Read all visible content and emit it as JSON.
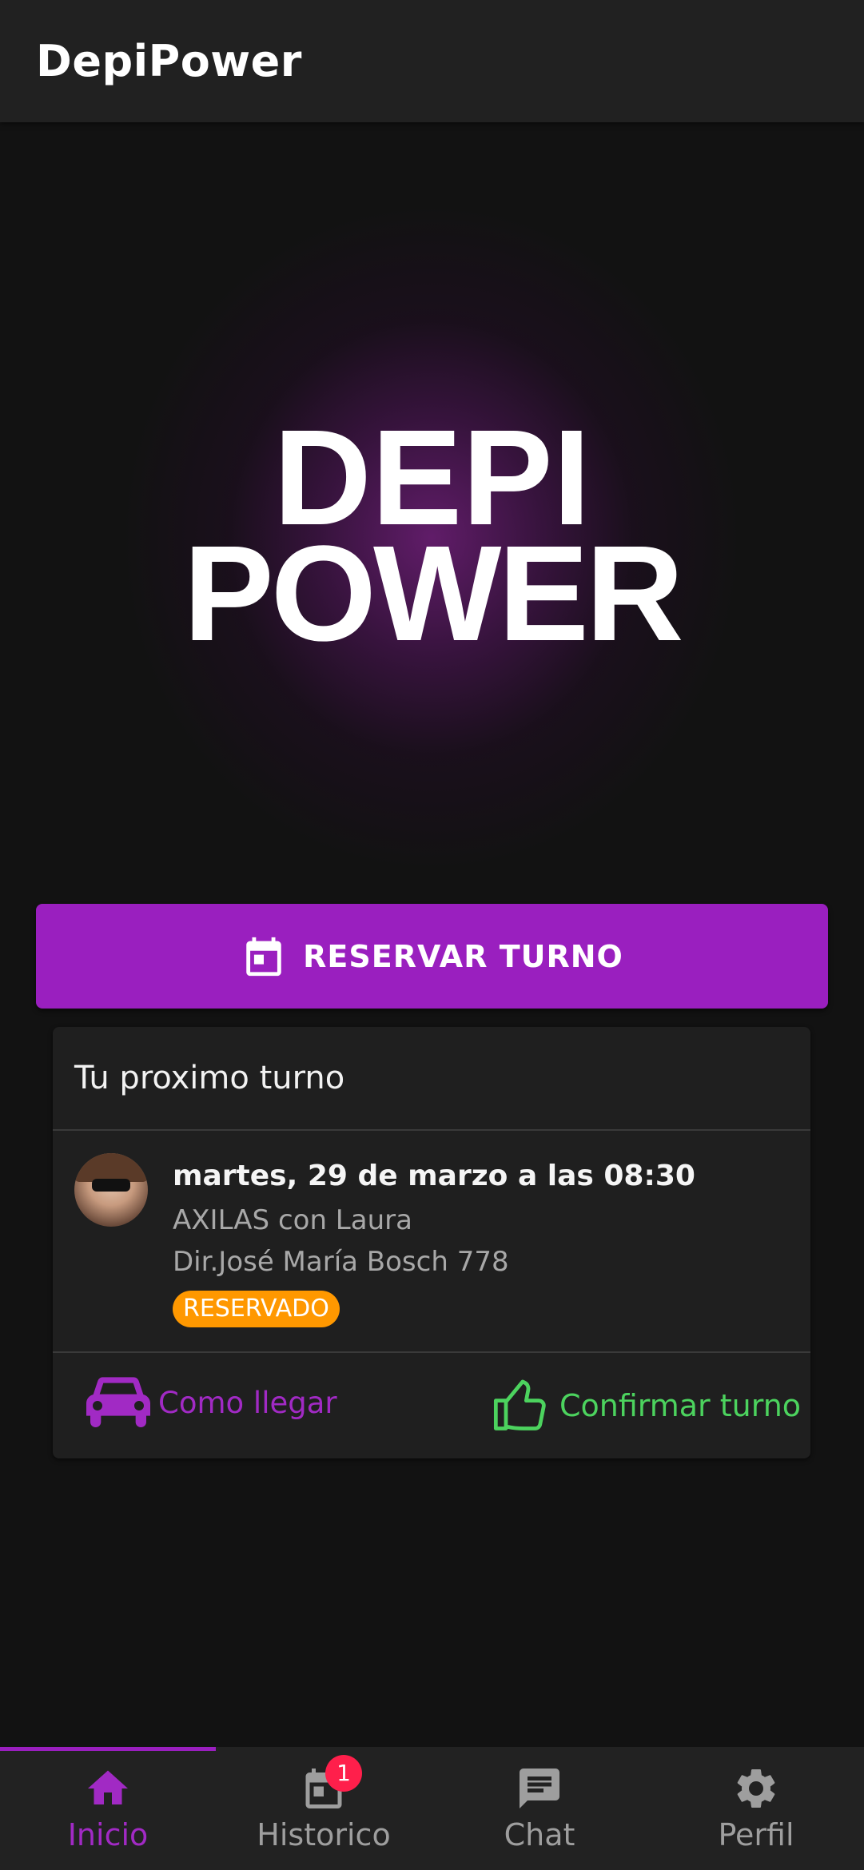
{
  "app": {
    "title": "DepiPower"
  },
  "hero": {
    "logo_line1": "DEPI",
    "logo_line2": "POWER"
  },
  "reserve_button": {
    "label": "RESERVAR TURNO",
    "icon": "calendar-icon"
  },
  "next_appointment": {
    "title": "Tu proximo turno",
    "date": "martes, 29 de marzo a las 08:30",
    "service": "AXILAS con Laura",
    "address": "Dir.José María Bosch 778",
    "status": "RESERVADO",
    "status_color": "#ff9800",
    "actions": {
      "directions": {
        "label": "Como llegar",
        "icon": "car-icon",
        "color": "#a12ac4"
      },
      "confirm": {
        "label": "Confirmar turno",
        "icon": "thumbs-up-icon",
        "color": "#4cd35e"
      }
    }
  },
  "bottom_nav": {
    "items": [
      {
        "label": "Inicio",
        "icon": "home-icon",
        "active": true
      },
      {
        "label": "Historico",
        "icon": "calendar-icon",
        "badge": "1"
      },
      {
        "label": "Chat",
        "icon": "chat-icon"
      },
      {
        "label": "Perfil",
        "icon": "gear-icon"
      }
    ]
  },
  "colors": {
    "accent": "#9a1fbf",
    "background": "#121212",
    "surface": "#1f1f1f"
  }
}
